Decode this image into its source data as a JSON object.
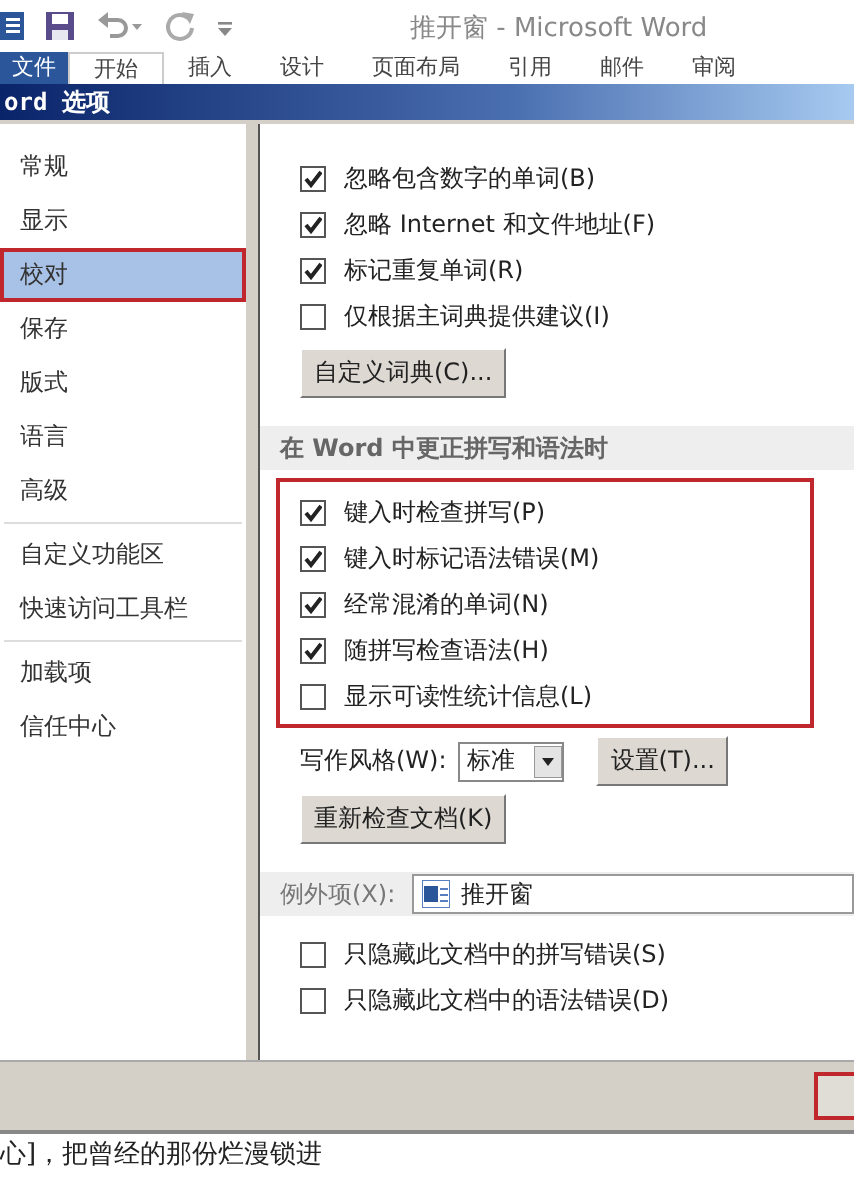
{
  "window": {
    "title": "推开窗 - Microsoft Word"
  },
  "ribbon_tabs": [
    {
      "label": "文件",
      "kind": "file",
      "selected": false
    },
    {
      "label": "开始",
      "kind": "tab",
      "selected": true
    },
    {
      "label": "插入",
      "kind": "tab",
      "selected": false
    },
    {
      "label": "设计",
      "kind": "tab",
      "selected": false
    },
    {
      "label": "页面布局",
      "kind": "tab",
      "selected": false
    },
    {
      "label": "引用",
      "kind": "tab",
      "selected": false
    },
    {
      "label": "邮件",
      "kind": "tab",
      "selected": false
    },
    {
      "label": "审阅",
      "kind": "tab",
      "selected": false
    }
  ],
  "dialog": {
    "title": "ord 选项"
  },
  "sidebar": {
    "groups": [
      [
        {
          "label": "常规",
          "selected": false,
          "highlighted": false
        },
        {
          "label": "显示",
          "selected": false,
          "highlighted": false
        },
        {
          "label": "校对",
          "selected": true,
          "highlighted": true
        },
        {
          "label": "保存",
          "selected": false,
          "highlighted": false
        },
        {
          "label": "版式",
          "selected": false,
          "highlighted": false
        },
        {
          "label": "语言",
          "selected": false,
          "highlighted": false
        },
        {
          "label": "高级",
          "selected": false,
          "highlighted": false
        }
      ],
      [
        {
          "label": "自定义功能区",
          "selected": false,
          "highlighted": false
        },
        {
          "label": "快速访问工具栏",
          "selected": false,
          "highlighted": false
        }
      ],
      [
        {
          "label": "加载项",
          "selected": false,
          "highlighted": false
        },
        {
          "label": "信任中心",
          "selected": false,
          "highlighted": false
        }
      ]
    ]
  },
  "office_options": [
    {
      "label": "忽略包含数字的单词(B)",
      "checked": true
    },
    {
      "label": "忽略 Internet 和文件地址(F)",
      "checked": true
    },
    {
      "label": "标记重复单词(R)",
      "checked": true
    },
    {
      "label": "仅根据主词典提供建议(I)",
      "checked": false
    }
  ],
  "custom_dictionaries_button": "自定义词典(C)...",
  "word_section": {
    "heading": "在 Word 中更正拼写和语法时",
    "highlighted": true,
    "options": [
      {
        "label": "键入时检查拼写(P)",
        "checked": true
      },
      {
        "label": "键入时标记语法错误(M)",
        "checked": true
      },
      {
        "label": "经常混淆的单词(N)",
        "checked": true
      },
      {
        "label": "随拼写检查语法(H)",
        "checked": true
      },
      {
        "label": "显示可读性统计信息(L)",
        "checked": false
      }
    ],
    "writing_style": {
      "label": "写作风格(W):",
      "value": "标准"
    },
    "settings_button": "设置(T)...",
    "recheck_button": "重新检查文档(K)"
  },
  "exceptions": {
    "label": "例外项(X):",
    "value": "推开窗",
    "options": [
      {
        "label": "只隐藏此文档中的拼写错误(S)",
        "checked": false
      },
      {
        "label": "只隐藏此文档中的语法错误(D)",
        "checked": false
      }
    ]
  },
  "footer": {
    "highlighted": true
  },
  "document_text": "心]，把曾经的那份烂漫锁进"
}
